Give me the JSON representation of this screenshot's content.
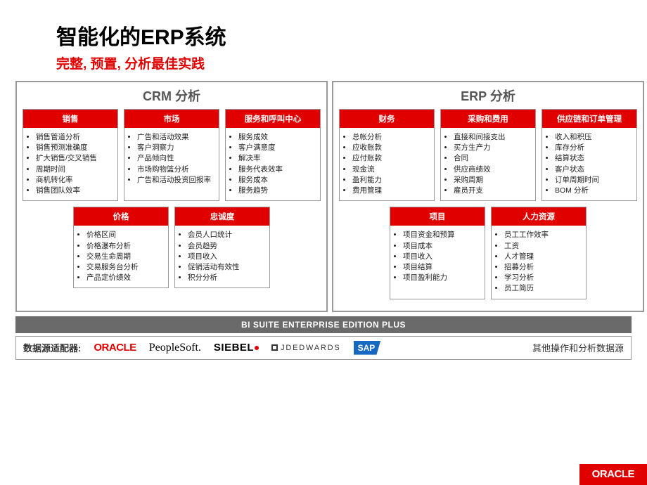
{
  "title": "智能化的ERP系统",
  "subtitle": "完整, 预置, 分析最佳实践",
  "bi_bar": "BI SUITE ENTERPRISE EDITION PLUS",
  "adapter_label": "数据源适配器:",
  "other_sources": "其他操作和分析数据源",
  "logos": {
    "oracle": "ORACLE",
    "peoplesoft": "PeopleSoft.",
    "siebel": "SIEBEL",
    "jde": "JDEDWARDS",
    "sap": "SAP"
  },
  "footer_logo": "ORACLE",
  "panels": [
    {
      "title": "CRM 分析",
      "rows": [
        [
          {
            "header": "销售",
            "items": [
              "销售管道分析",
              "销售预测准确度",
              "扩大销售/交叉销售",
              "周期时间",
              "商机转化率",
              "销售团队效率"
            ]
          },
          {
            "header": "市场",
            "items": [
              "广告和活动效果",
              "客户洞察力",
              "产品倾向性",
              "市场购物篮分析",
              "广告和活动投资回报率"
            ]
          },
          {
            "header": "服务和呼叫中心",
            "items": [
              "服务成效",
              "客户满意度",
              "解决率",
              "服务代表效率",
              "服务成本",
              "服务趋势"
            ]
          }
        ],
        [
          {
            "header": "价格",
            "items": [
              "价格区间",
              "价格瀑布分析",
              "交易生命周期",
              "交易服务台分析",
              "产品定价绩效"
            ]
          },
          {
            "header": "忠诚度",
            "items": [
              "会员人口统计",
              "会员趋势",
              "项目收入",
              "促销活动有效性",
              "积分分析"
            ]
          }
        ]
      ]
    },
    {
      "title": "ERP 分析",
      "rows": [
        [
          {
            "header": "财务",
            "items": [
              "总帐分析",
              "应收账款",
              "应付账款",
              "现金流",
              "盈利能力",
              "费用管理"
            ]
          },
          {
            "header": "采购和费用",
            "items": [
              "直接和间接支出",
              "买方生产力",
              "合同",
              "供应商绩效",
              "采购周期",
              "雇员开支"
            ]
          },
          {
            "header": "供应链和订单管理",
            "items": [
              "收入和积压",
              "库存分析",
              "结算状态",
              "客户状态",
              "订单周期时间",
              "BOM 分析"
            ]
          }
        ],
        [
          {
            "header": "项目",
            "items": [
              "项目资金和预算",
              "项目成本",
              "项目收入",
              "项目结算",
              "项目盈利能力"
            ]
          },
          {
            "header": "人力资源",
            "items": [
              "员工工作效率",
              "工资",
              "人才管理",
              "招募分析",
              "学习分析",
              "员工简历"
            ]
          }
        ]
      ]
    }
  ]
}
